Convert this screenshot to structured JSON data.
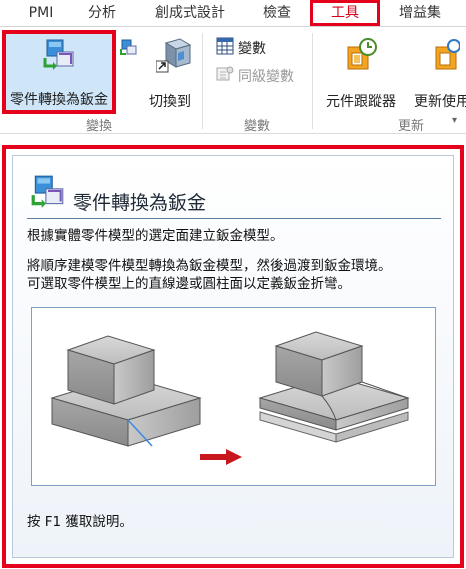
{
  "tabs": [
    {
      "label": "PMI",
      "active": false
    },
    {
      "label": "分析",
      "active": false
    },
    {
      "label": "創成式設計",
      "active": false
    },
    {
      "label": "檢查",
      "active": false
    },
    {
      "label": "工具",
      "active": true
    },
    {
      "label": "增益集",
      "active": false
    }
  ],
  "ribbon": {
    "convert_button": {
      "label": "零件轉換為鈑金",
      "icon": "part-to-sheetmetal-icon"
    },
    "switch_button": {
      "label": "切換到",
      "icon": "switch-to-icon"
    },
    "group_convert": "變換",
    "variables_button": {
      "label": "變數",
      "icon": "variables-icon"
    },
    "same_level_button": {
      "label": "同級變數",
      "icon": "same-level-variables-icon",
      "disabled": true
    },
    "group_variables": "變數",
    "component_tracker_button": {
      "label": "元件跟蹤器",
      "icon": "component-tracker-icon"
    },
    "update_button": {
      "label": "更新使用",
      "icon": "update-icon"
    },
    "group_update": "更新"
  },
  "tooltip": {
    "title": "零件轉換為鈑金",
    "description": "根據實體零件模型的選定面建立鈑金模型。",
    "detail_line1": "將順序建模零件模型轉換為鈑金模型，然後過渡到鈑金環境。",
    "detail_line2": "可選取零件模型上的直線邊或圓柱面以定義鈑金折彎。",
    "help": "按 F1 獲取說明。",
    "illustration": "solid-block-to-sheetmetal-illustration"
  },
  "colors": {
    "highlight_border": "#e5001c",
    "active_tab_text": "#d6001c",
    "selected_button_bg": "#cfe6f8",
    "title_rule": "#5a7da6"
  }
}
